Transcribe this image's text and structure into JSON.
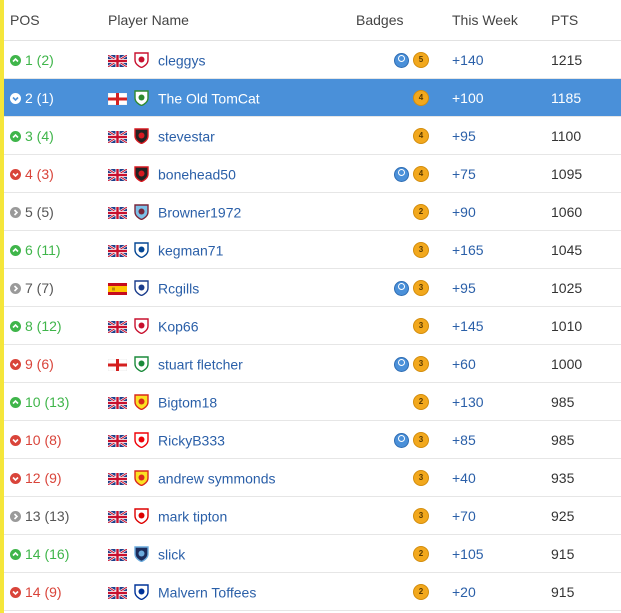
{
  "headers": {
    "pos": "POS",
    "player": "Player Name",
    "badges": "Badges",
    "week": "This Week",
    "pts": "PTS"
  },
  "rows": [
    {
      "pos": "1 (2)",
      "trend": "up",
      "flag": "uk",
      "crest": "liverpool",
      "name": "cleggys",
      "badges": [
        "blue",
        "5"
      ],
      "week": "+140",
      "pts": "1215"
    },
    {
      "pos": "2 (1)",
      "trend": "down",
      "flag": "england",
      "crest": "forest-green",
      "name": "The Old TomCat",
      "badges": [
        "4"
      ],
      "week": "+100",
      "pts": "1185",
      "highlight": true
    },
    {
      "pos": "3 (4)",
      "trend": "up",
      "flag": "uk",
      "crest": "cherries",
      "name": "stevestar",
      "badges": [
        "4"
      ],
      "week": "+95",
      "pts": "1100"
    },
    {
      "pos": "4 (3)",
      "trend": "down",
      "flag": "uk",
      "crest": "cherries",
      "name": "bonehead50",
      "badges": [
        "blue",
        "4"
      ],
      "week": "+75",
      "pts": "1095"
    },
    {
      "pos": "5 (5)",
      "trend": "same",
      "flag": "uk",
      "crest": "west-ham",
      "name": "Browner1972",
      "badges": [
        "2"
      ],
      "week": "+90",
      "pts": "1060"
    },
    {
      "pos": "6 (11)",
      "trend": "up",
      "flag": "uk",
      "crest": "chelsea",
      "name": "kegman71",
      "badges": [
        "3"
      ],
      "week": "+165",
      "pts": "1045"
    },
    {
      "pos": "7 (7)",
      "trend": "same",
      "flag": "spain",
      "crest": "gillingham",
      "name": "Rcgills",
      "badges": [
        "blue",
        "3"
      ],
      "week": "+95",
      "pts": "1025"
    },
    {
      "pos": "8 (12)",
      "trend": "up",
      "flag": "uk",
      "crest": "liverpool",
      "name": "Kop66",
      "badges": [
        "3"
      ],
      "week": "+145",
      "pts": "1010"
    },
    {
      "pos": "9 (6)",
      "trend": "down",
      "flag": "england",
      "crest": "celtic",
      "name": "stuart fletcher",
      "badges": [
        "blue",
        "3"
      ],
      "week": "+60",
      "pts": "1000"
    },
    {
      "pos": "10 (13)",
      "trend": "up",
      "flag": "uk",
      "crest": "man-utd",
      "name": "Bigtom18",
      "badges": [
        "2"
      ],
      "week": "+130",
      "pts": "985"
    },
    {
      "pos": "10 (8)",
      "trend": "down",
      "flag": "uk",
      "crest": "arsenal",
      "name": "RickyB333",
      "badges": [
        "blue",
        "3"
      ],
      "week": "+85",
      "pts": "985"
    },
    {
      "pos": "12 (9)",
      "trend": "down",
      "flag": "uk",
      "crest": "man-utd",
      "name": "andrew symmonds",
      "badges": [
        "3"
      ],
      "week": "+40",
      "pts": "935"
    },
    {
      "pos": "13 (13)",
      "trend": "same",
      "flag": "uk",
      "crest": "forest",
      "name": "mark tipton",
      "badges": [
        "3"
      ],
      "week": "+70",
      "pts": "925"
    },
    {
      "pos": "14 (16)",
      "trend": "up",
      "flag": "uk",
      "crest": "man-city",
      "name": "slick",
      "badges": [
        "2"
      ],
      "week": "+105",
      "pts": "915"
    },
    {
      "pos": "14 (9)",
      "trend": "down",
      "flag": "uk",
      "crest": "everton",
      "name": "Malvern Toffees",
      "badges": [
        "2"
      ],
      "week": "+20",
      "pts": "915"
    }
  ],
  "colors": {
    "up": "#3fb54a",
    "down": "#d9443a",
    "same": "#9a9a9a",
    "highlight": "#4a90d9",
    "link": "#2a5fa8",
    "badge": "#f2a81d"
  }
}
